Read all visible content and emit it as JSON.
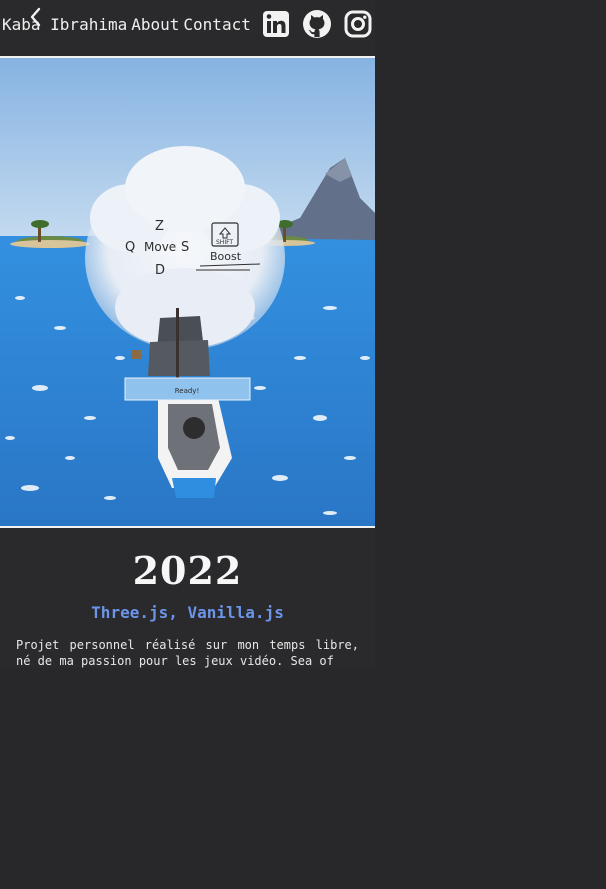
{
  "nav": {
    "name": "Kaba Ibrahima",
    "about": "About",
    "contact": "Contact",
    "back_icon": "chevron-left-icon",
    "social": [
      "linkedin-icon",
      "github-icon",
      "instagram-icon"
    ]
  },
  "hero": {
    "controls": {
      "z": "Z",
      "q": "Q",
      "move": "Move",
      "s": "S",
      "d": "D",
      "shift": "SHIFT",
      "boost": "Boost",
      "ready": "Ready!"
    }
  },
  "project": {
    "year": "2022",
    "tech": "Three.js, Vanilla.js",
    "description": "Projet personnel réalisé sur mon temps libre, né de ma passion pour les jeux vidéo. Sea of"
  },
  "colors": {
    "background": "#28282a",
    "accent": "#6c95ea",
    "sea": "#2f83d6",
    "sky": "#9bc2ea",
    "text": "#e8e8e8"
  }
}
